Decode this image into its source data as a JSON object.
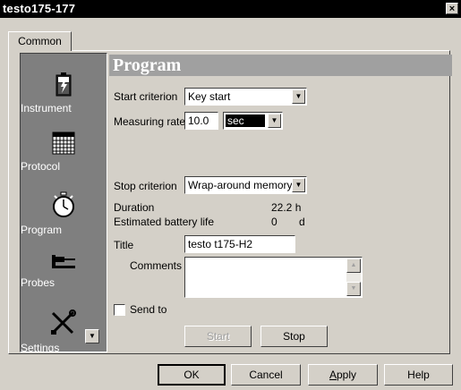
{
  "window": {
    "title": "testo175-177",
    "close_glyph": "×"
  },
  "tab": {
    "label": "Common"
  },
  "sidebar": {
    "items": [
      {
        "label": "Instrument",
        "icon": "battery-icon"
      },
      {
        "label": "Protocol",
        "icon": "table-grid-icon"
      },
      {
        "label": "Program",
        "icon": "stopwatch-icon"
      },
      {
        "label": "Probes",
        "icon": "probe-icon"
      },
      {
        "label": "Settings",
        "icon": "tools-icon"
      }
    ],
    "scroll_glyph": "▼"
  },
  "program": {
    "heading": "Program",
    "start_criterion_label": "Start criterion",
    "start_criterion_value": "Key start",
    "measuring_rate_label": "Measuring rate",
    "measuring_rate_value": "10.0",
    "measuring_rate_unit": "sec",
    "stop_criterion_label": "Stop criterion",
    "stop_criterion_value": "Wrap-around memory",
    "duration_label": "Duration",
    "duration_value": "22.2 h",
    "battery_label": "Estimated battery life",
    "battery_value": "0",
    "battery_unit": "d",
    "title_label": "Title",
    "title_value": "testo t175-H2",
    "comments_label": "Comments",
    "comments_value": "",
    "send_to_label": "Send to",
    "start_button": "Start",
    "stop_button": "Stop"
  },
  "footer": {
    "ok": "OK",
    "cancel": "Cancel",
    "apply_first": "A",
    "apply_rest": "pply",
    "help": "Help"
  },
  "glyphs": {
    "combo_arrow": "▼",
    "scroll_up": "▲",
    "scroll_down": "▼"
  }
}
